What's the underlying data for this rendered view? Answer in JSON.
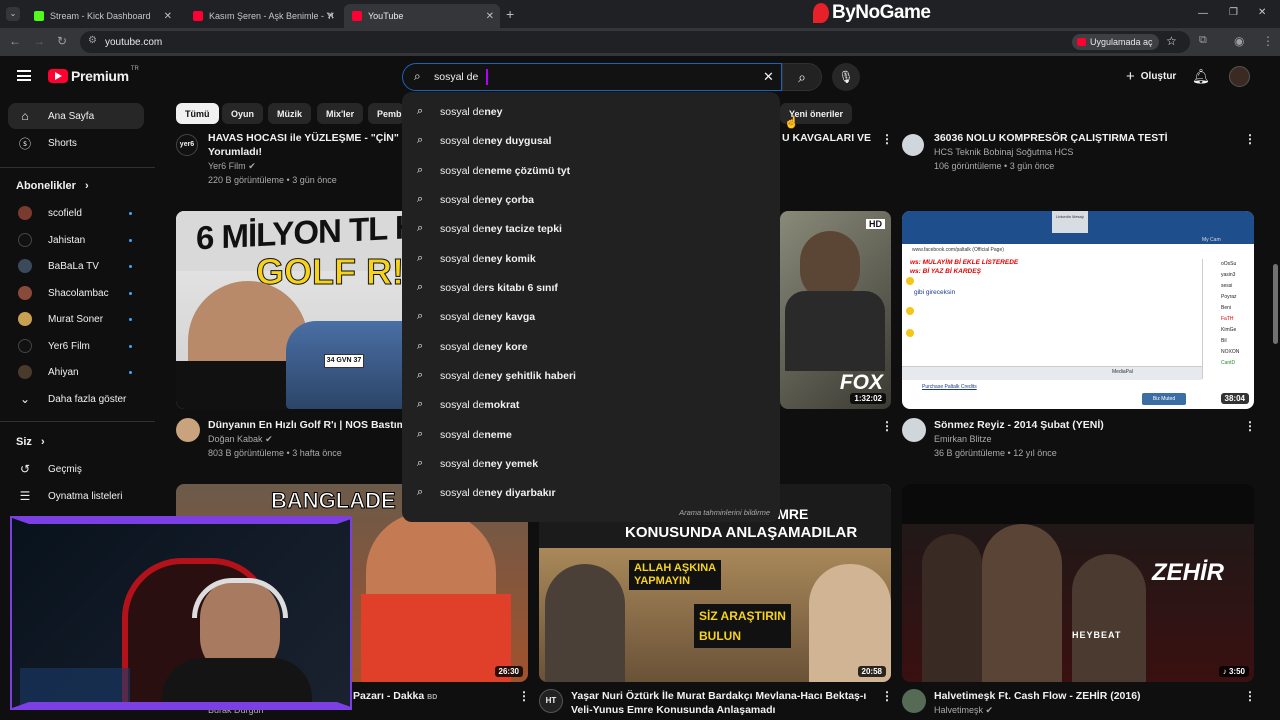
{
  "browser": {
    "tabs": [
      {
        "title": "Stream - Kick Dashboard"
      },
      {
        "title": "Kasım Şeren - Aşk Benimle - Yo"
      },
      {
        "title": "YouTube"
      }
    ],
    "url": "youtube.com",
    "brand_overlay": "ByNoGame",
    "open_in_app": "Uygulamada aç"
  },
  "yt": {
    "logo": "Premium",
    "logo_sup": "TR",
    "search_value": "sosyal de",
    "create_label": "Oluştur",
    "chips": [
      "Tümü",
      "Oyun",
      "Müzik",
      "Mix'ler",
      "Pemb",
      "Yeni öneriler"
    ],
    "sidebar": {
      "main": [
        {
          "label": "Ana Sayfa"
        },
        {
          "label": "Shorts"
        }
      ],
      "subs_header": "Abonelikler",
      "subs": [
        {
          "label": "scofield"
        },
        {
          "label": "Jahistan"
        },
        {
          "label": "BaBaLa TV"
        },
        {
          "label": "Shacolambac"
        },
        {
          "label": "Murat Soner"
        },
        {
          "label": "Yer6 Film"
        },
        {
          "label": "Ahiyan"
        }
      ],
      "show_more": "Daha fazla göster",
      "you_header": "Siz",
      "you": [
        {
          "label": "Geçmiş"
        },
        {
          "label": "Oynatma listeleri"
        }
      ]
    },
    "suggestions": [
      "sosyal deney",
      "sosyal deney duygusal",
      "sosyal deneme çözümü tyt",
      "sosyal deney çorba",
      "sosyal deney tacize tepki",
      "sosyal deney komik",
      "sosyal ders kitabı 6 sınıf",
      "sosyal deney kavga",
      "sosyal deney kore",
      "sosyal deney şehitlik haberi",
      "sosyal demokrat",
      "sosyal deneme",
      "sosyal deney yemek",
      "sosyal deney diyarbakır"
    ],
    "suggestions_footer": "Arama tahminlerini bildirme",
    "videos": {
      "r1a": {
        "title1": "HAVAS HOCASI ile YÜZLEŞME - \"ÇİN\" Fil",
        "title2": "Yorumladı!",
        "channel": "Yer6 Film",
        "meta": "220 B görüntüleme • 3 gün önce",
        "avatar": "yer6"
      },
      "r1c": {
        "title": "U KAVGALARI VE"
      },
      "r1d": {
        "title": "36036 NOLU KOMPRESÖR ÇALIŞTIRMA TESTİ",
        "channel": "HCS Teknik Bobinaj Soğutma HCS",
        "meta": "106 görüntüleme • 3 gün önce"
      },
      "r2a": {
        "title": "Dünyanın En Hızlı Golf R'ı | NOS Bastım!",
        "channel": "Doğan Kabak",
        "meta": "803 B görüntüleme • 3 hafta önce",
        "thumb_text1": "6 MİLYON TL HA",
        "thumb_text2": "GOLF R!",
        "plate": "34 GVN 37"
      },
      "r2c": {
        "duration": "1:32:02",
        "badge": "HD",
        "logo": "FOX"
      },
      "r2d": {
        "title": "Sönmez Reyiz - 2014 Şubat (YENİ)",
        "channel": "Emirkan Blitze",
        "meta": "36 B görüntüleme • 12 yıl önce",
        "duration": "38:04",
        "chat1": "ws: MULAYİM Bİ EKLE LİSTEREDE",
        "chat2": "ws: Bİ YAZ Bİ KARDEŞ",
        "chat3": "gibi gireceksin",
        "footer_link": "Purchase Paltalk Credits",
        "tab_label": "MediaPal",
        "header_link": "Linkedin Mesajı",
        "cam_label": "My Cam",
        "url_text": "www.facebook.com/paltalk (Official Page)",
        "users": [
          "oOsSu",
          "yasin3",
          "sessi",
          "Poyraz",
          "Beni",
          "FaTH",
          "KimGe",
          "Bil",
          "NOXON",
          "CantD"
        ],
        "btn_label": "Biz Muted"
      },
      "r3a": {
        "title": "Pazarı - Dakka",
        "suffix": "BD",
        "channel": "Burak Durgun",
        "duration": "26:30",
        "thumb_text": "BANGLADE"
      },
      "r3c": {
        "title1": "Yaşar Nuri Öztürk İle Murat Bardakçı Mevlana-Hacı Bektaş-ı",
        "title2": "Veli-Yunus Emre Konusunda Anlaşamadı",
        "duration": "20:58",
        "t1": "YUNUS EMRE",
        "t2": "KONUSUNDA ANLAŞAMADILAR",
        "t3": "ALLAH AŞKINA",
        "t4": "YAPMAYIN",
        "t5": "SİZ ARAŞTIRIN",
        "t6": "BULUN",
        "avatar": "HT"
      },
      "r3d": {
        "title": "Halvetimeşk Ft. Cash Flow - ZEHİR (2016)",
        "channel": "Halvetimeşk",
        "duration": "3:50",
        "thumb_text": "ZEHİR",
        "sub_text": "HEYBEAT"
      }
    }
  },
  "colors": {
    "yt_red": "#ff0033",
    "accent": "#3ea6ff",
    "bg": "#0f0f0f"
  }
}
